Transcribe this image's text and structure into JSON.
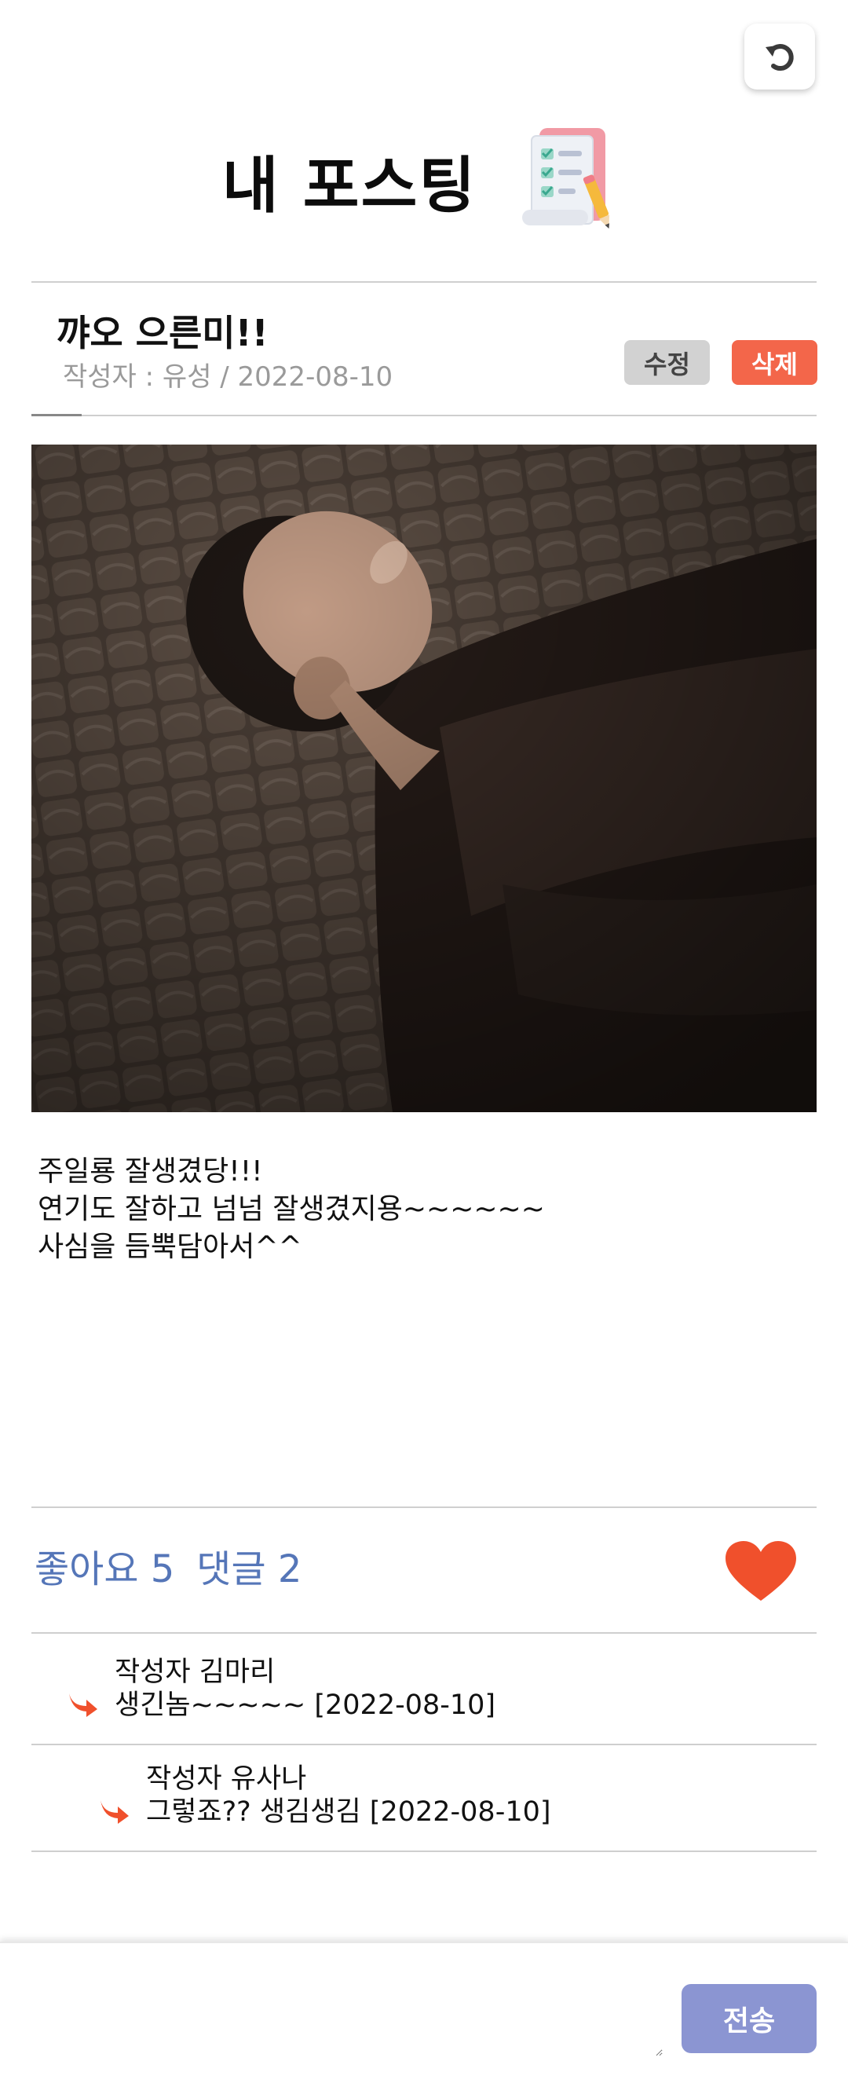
{
  "header": {
    "title": "내 포스팅"
  },
  "post": {
    "title": "꺄오 으른미!!",
    "meta": "작성자 : 유성 / 2022-08-10",
    "edit_label": "수정",
    "delete_label": "삭제",
    "body": [
      "주일룡 잘생겼당!!!",
      "",
      "연기도 잘하고 넘넘 잘생겼지용~~~~~~",
      "사심을 듬뿍담아서^^"
    ]
  },
  "stats": {
    "likes": "좋아요 5",
    "comments": "댓글 2"
  },
  "comments": [
    {
      "author": "작성자 김마리",
      "text": "생긴놈~~~~~ [2022-08-10]"
    },
    {
      "author": "작성자 유사나",
      "text": "그렇죠?? 생김생김 [2022-08-10]"
    }
  ],
  "composer": {
    "input_value": "",
    "send_label": "전송"
  },
  "colors": {
    "accent_blue": "#5576b8",
    "delete_red": "#f3664a",
    "heart_red": "#f0502c",
    "send_purple": "#8b95d2",
    "edit_gray": "#d2d2d2"
  },
  "icons": {
    "refresh": "refresh-icon",
    "title_decoration": "checklist-icon",
    "like": "heart-icon",
    "reply": "reply-arrow-icon"
  }
}
